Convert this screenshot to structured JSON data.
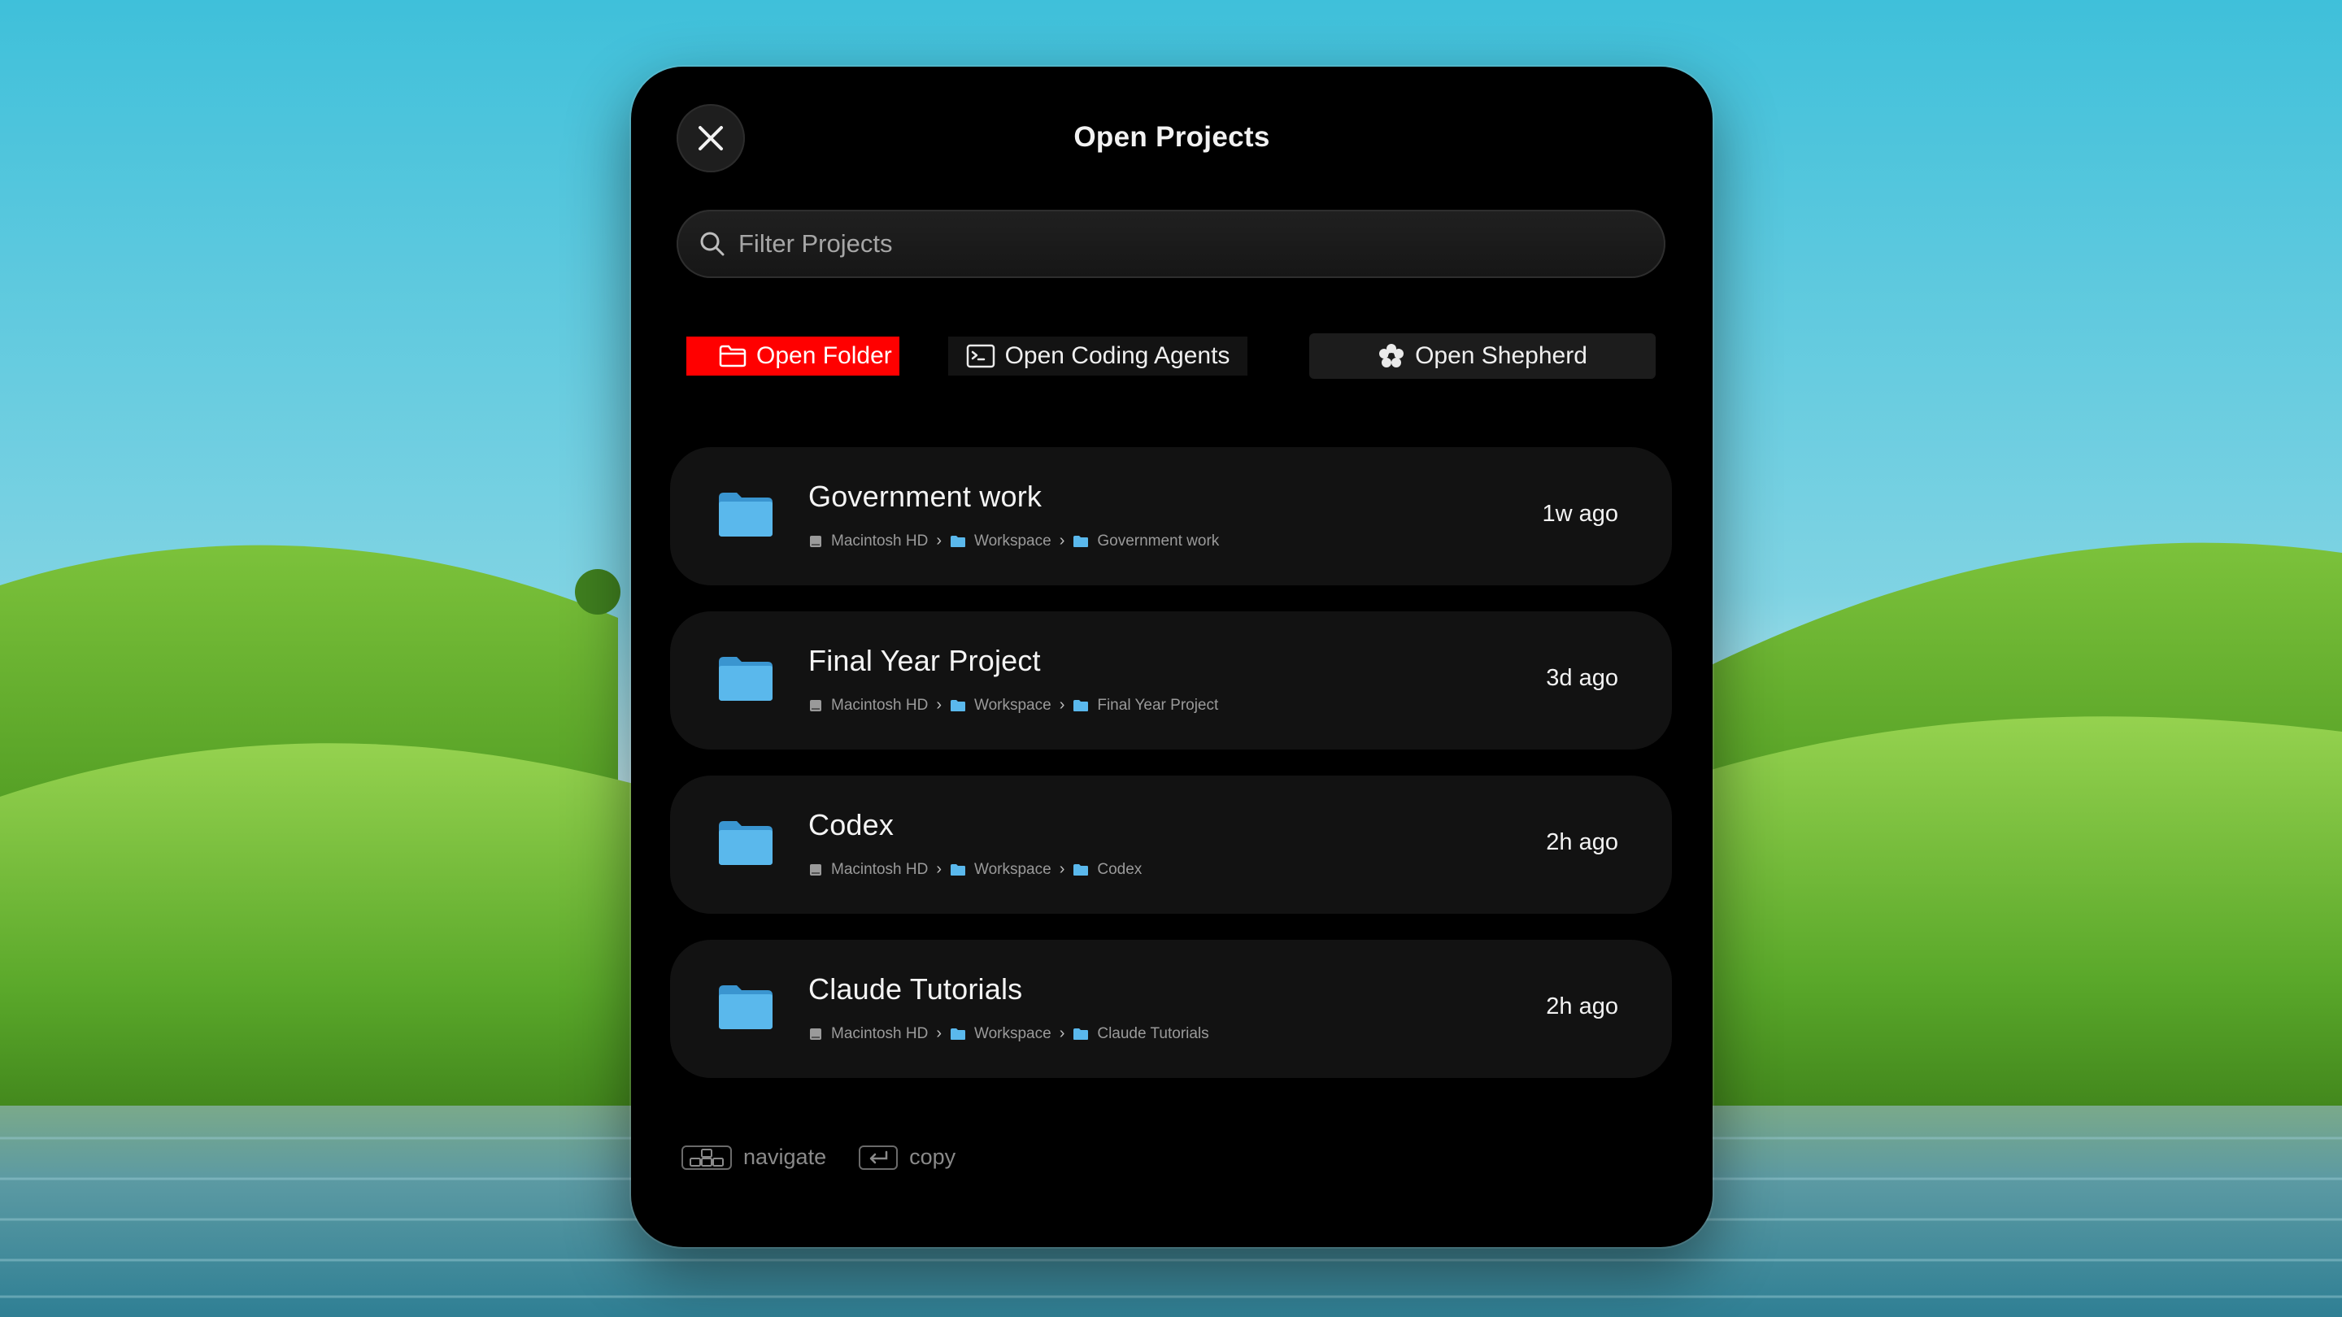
{
  "dialog": {
    "title": "Open Projects",
    "close_icon": "close-icon"
  },
  "search": {
    "placeholder": "Filter Projects",
    "value": ""
  },
  "actions": {
    "open_folder": "Open Folder",
    "open_coding_agents": "Open Coding Agents",
    "open_shepherd": "Open Shepherd",
    "open_folder_color": "#ff0000"
  },
  "projects": [
    {
      "name": "Government work",
      "path": [
        "Macintosh HD",
        "Workspace",
        "Government work"
      ],
      "time": "1w ago"
    },
    {
      "name": "Final Year Project",
      "path": [
        "Macintosh HD",
        "Workspace",
        "Final Year Project"
      ],
      "time": "3d ago"
    },
    {
      "name": "Codex",
      "path": [
        "Macintosh HD",
        "Workspace",
        "Codex"
      ],
      "time": "2h ago"
    },
    {
      "name": "Claude Tutorials",
      "path": [
        "Macintosh HD",
        "Workspace",
        "Claude Tutorials"
      ],
      "time": "2h ago"
    }
  ],
  "hints": {
    "navigate": "navigate",
    "copy": "copy"
  },
  "colors": {
    "folder_blue": "#5ab8ec",
    "panel_bg": "#000000",
    "row_bg": "#121212"
  }
}
